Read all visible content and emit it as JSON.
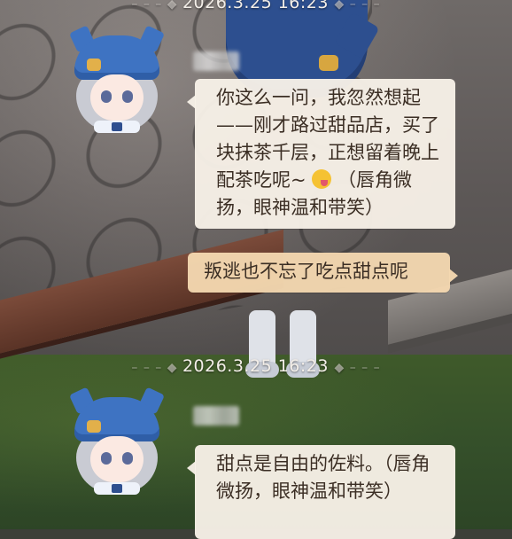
{
  "chat": {
    "messages": [
      {
        "timestamp": "2026.3.25  16:23",
        "sender": "npc",
        "text_before": "你这么一问，我忽然想起——刚才路过甜品店，买了块抹茶千层，正想留着晚上配茶吃呢~",
        "emoji": "yum-face-emoji",
        "text_after": "（唇角微扬，眼神温和带笑）"
      },
      {
        "sender": "player",
        "text": "叛逃也不忘了吃点甜点呢"
      },
      {
        "timestamp": "2026.3.25  16:23",
        "sender": "npc",
        "text": "甜点是自由的佐料。（唇角微扬，眼神温和带笑）"
      }
    ]
  },
  "icons": {
    "timestamp_decor": "diamond-dash-decor",
    "avatar": "chibi-character-avatar",
    "name_placeholder": "blurred-name"
  },
  "colors": {
    "npc_bubble": "#f7f0e7",
    "player_bubble": "#f4d7b0",
    "timestamp_text": "#f3eee8"
  }
}
